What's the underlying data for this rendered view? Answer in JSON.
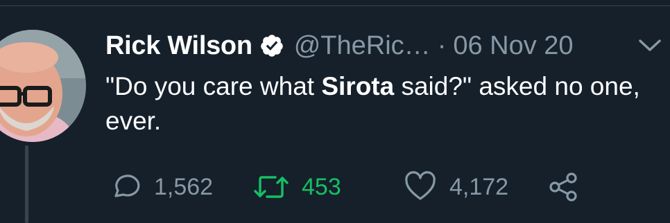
{
  "tweet": {
    "author_name": "Rick Wilson",
    "handle": "@TheRic…",
    "separator": "·",
    "timestamp": "06 Nov 20",
    "text_before": "\"Do you care what ",
    "text_bold": "Sirota",
    "text_after": " said?\" asked no one, ever."
  },
  "actions": {
    "replies": "1,562",
    "retweets": "453",
    "likes": "4,172"
  },
  "icons": {
    "verified": "verified-badge-icon",
    "menu": "chevron-down-icon",
    "reply": "speech-bubble-icon",
    "retweet": "retweet-arrows-icon",
    "like": "heart-icon",
    "share": "share-icon"
  },
  "colors": {
    "background": "#15202b",
    "muted_text": "#8899a6",
    "retweet_active": "#17bf63",
    "thread_line": "#38444d"
  }
}
